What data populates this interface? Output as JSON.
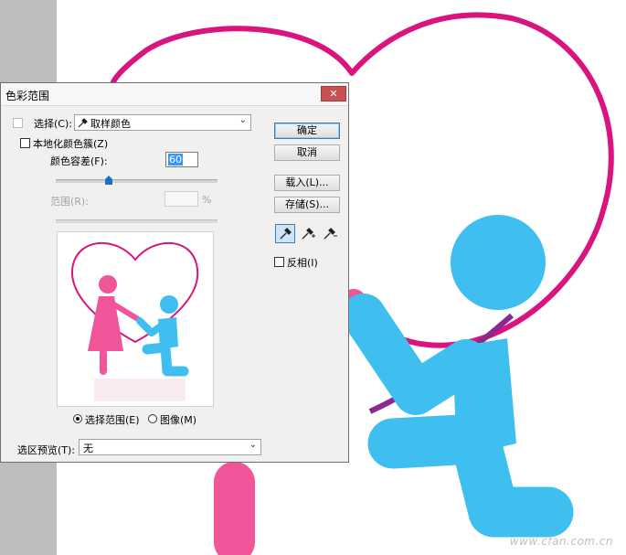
{
  "dialog": {
    "title": "色彩范围",
    "close_glyph": "✕",
    "select_label": "选择(C):",
    "select_value": "取样颜色",
    "localized_label": "本地化颜色簇(Z)",
    "tolerance_label": "颜色容差(F):",
    "tolerance_value": "60",
    "range_label": "范围(R):",
    "range_unit": "%",
    "radio_selection": "选择范围(E)",
    "radio_image": "图像(M)",
    "preview_label": "选区预览(T):",
    "preview_value": "无",
    "invert_label": "反相(I)",
    "slider_level": 0.33
  },
  "buttons": {
    "ok": "确定",
    "cancel": "取消",
    "load": "载入(L)...",
    "save": "存储(S)..."
  },
  "tools": [
    "eyedropper-icon",
    "eyedropper-plus-icon",
    "eyedropper-minus-icon"
  ],
  "colors": {
    "heart": "#d9147f",
    "figure_blue": "#3fbfef",
    "figure_pink": "#f0559a",
    "bg_bar": "#bdbdbd"
  },
  "watermark": "www.cfan.com.cn"
}
